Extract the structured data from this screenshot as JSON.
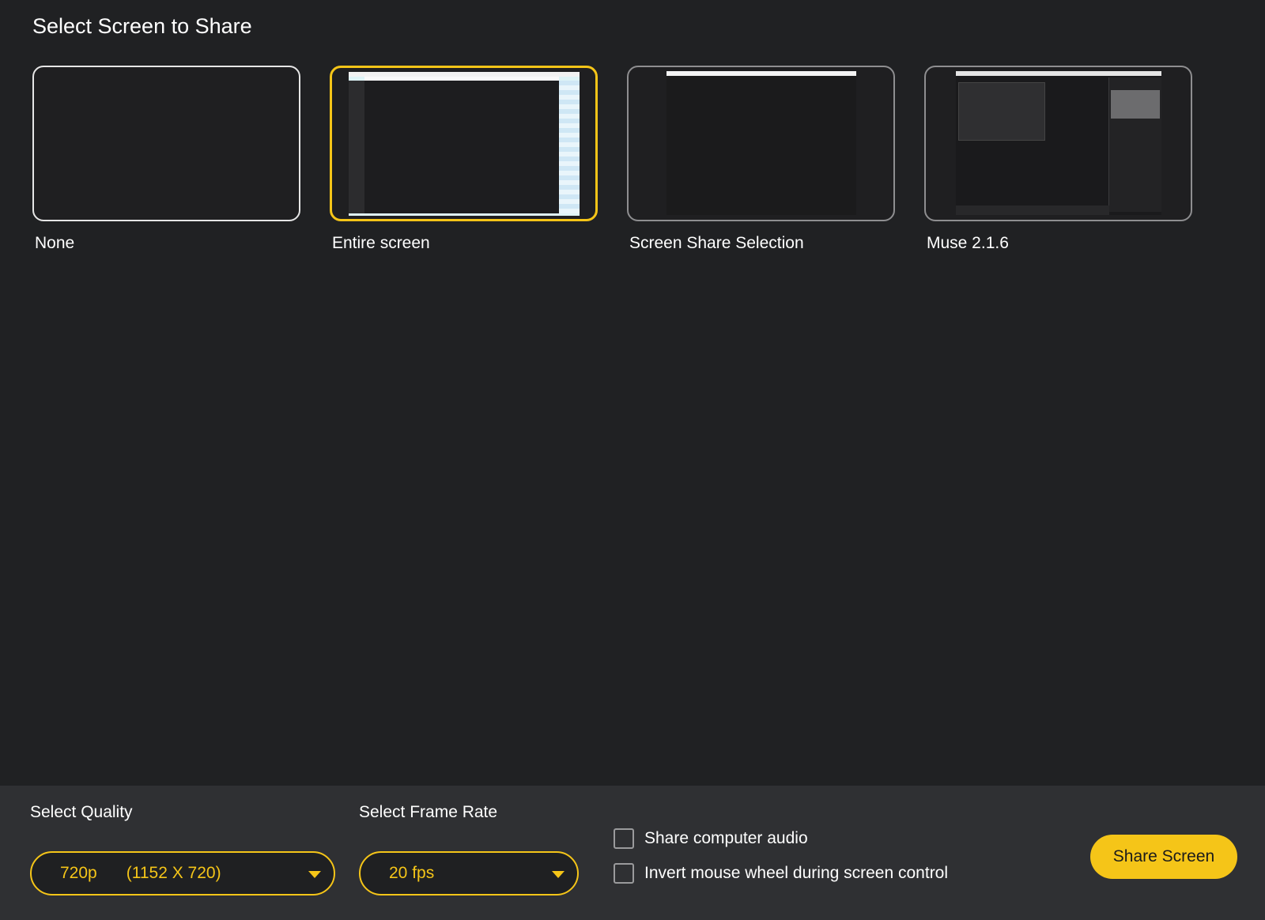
{
  "header": {
    "title": "Select Screen to Share"
  },
  "sources": [
    {
      "label": "None",
      "selected": false
    },
    {
      "label": "Entire screen",
      "selected": true
    },
    {
      "label": "Screen Share Selection",
      "selected": false
    },
    {
      "label": "Muse 2.1.6",
      "selected": false
    }
  ],
  "quality": {
    "label": "Select Quality",
    "value": "720p",
    "resolution": "(1152 X 720)"
  },
  "frame_rate": {
    "label": "Select Frame Rate",
    "value": "20 fps"
  },
  "options": {
    "share_audio": {
      "label": "Share computer audio",
      "checked": false
    },
    "invert_mouse_wheel": {
      "label": "Invert mouse wheel during screen control",
      "checked": false
    }
  },
  "actions": {
    "share_label": "Share Screen"
  },
  "colors": {
    "accent": "#f5c518",
    "background": "#202123",
    "footer": "#2f3033"
  }
}
